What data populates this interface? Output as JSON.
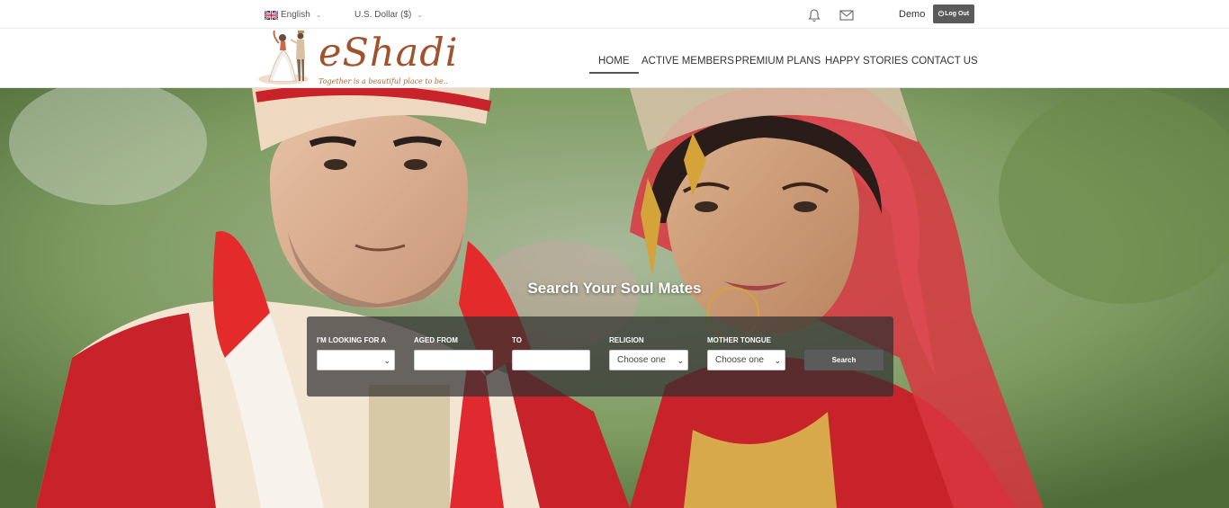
{
  "topbar": {
    "language": "English",
    "currency": "U.S. Dollar ($)",
    "user_name": "Demo",
    "logout_label": "Log Out",
    "icons": [
      "uk-flag-icon",
      "chevron-down-icon",
      "bell-icon",
      "mail-icon",
      "power-icon"
    ]
  },
  "header": {
    "logo_text": "eShadi",
    "tagline": "Together is a beautiful place to be..",
    "nav": [
      {
        "label": "HOME",
        "active": true
      },
      {
        "label": "ACTIVE MEMBERS",
        "active": false
      },
      {
        "label": "PREMIUM PLANS",
        "active": false
      },
      {
        "label": "HAPPY STORIES",
        "active": false
      },
      {
        "label": "CONTACT US",
        "active": false
      }
    ]
  },
  "hero": {
    "title": "Search Your Soul Mates",
    "search": {
      "looking_for_label": "I'M LOOKING FOR A",
      "looking_for_value": "",
      "aged_from_label": "AGED FROM",
      "aged_from_value": "",
      "to_label": "TO",
      "to_value": "",
      "religion_label": "RELIGION",
      "religion_value": "Choose one",
      "mother_tongue_label": "MOTHER TONGUE",
      "mother_tongue_value": "Choose one",
      "button_label": "Search"
    }
  },
  "colors": {
    "logo_brown": "#a0522d",
    "logout_bg": "#5a5a5a",
    "search_button_bg": "#5b5b5b",
    "search_panel_bg": "#303030"
  }
}
